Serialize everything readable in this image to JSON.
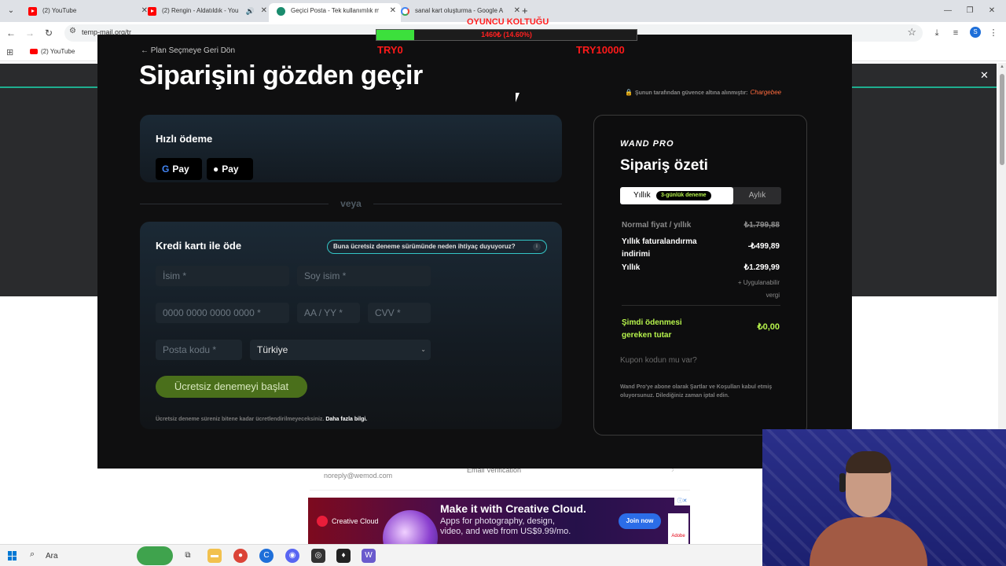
{
  "browser": {
    "tabs": [
      {
        "title": "(2) YouTube",
        "extra": ""
      },
      {
        "title": "(2) Rengin - Aldatıldık - You",
        "extra": "🔊"
      },
      {
        "title": "Geçici Posta - Tek kullanımlık m",
        "extra": ""
      },
      {
        "title": "sanal kart oluşturma - Google A",
        "extra": ""
      }
    ],
    "url": "temp-mail.org/tr",
    "bookmarks": [
      {
        "label": "(2) YouTube"
      }
    ],
    "profile_initial": "S"
  },
  "background_page": {
    "mail": {
      "from": "noreply@wemod.com",
      "subject": "Email Verification"
    }
  },
  "checkout": {
    "back_link": "← Plan Seçmeye Geri Dön",
    "title": "Siparişini gözden geçir",
    "secured_text": "Şunun tarafından güvence altına alınmıştır:",
    "secured_brand": "Chargebee",
    "fast_pay": {
      "title": "Hızlı ödeme",
      "google_pay": "Pay",
      "apple_pay": "Pay"
    },
    "or_text": "veya",
    "card_pay": {
      "title": "Kredi kartı ile öde",
      "why_pill": "Buna ücretsiz deneme sürümünde neden ihtiyaç duyuyoruz?",
      "first_name_placeholder": "İsim *",
      "last_name_placeholder": "Soy isim *",
      "card_number_placeholder": "0000 0000 0000 0000 *",
      "expiry_placeholder": "AA / YY *",
      "cvv_placeholder": "CVV *",
      "postal_placeholder": "Posta kodu *",
      "country_value": "Türkiye",
      "start_button": "Ücretsiz denemeyi başlat",
      "fine_print": "Ücretsiz deneme süreniz bitene kadar ücretlendirilmeyeceksiniz.",
      "more_info": "Daha fazla bilgi."
    },
    "summary": {
      "brand": "WAND PRO",
      "title": "Sipariş özeti",
      "toggle_yearly": "Yıllık",
      "trial_badge": "3-günlük deneme",
      "toggle_monthly": "Aylık",
      "rows": [
        {
          "label": "Normal fiyat / yıllık",
          "value": "₺1.799,88"
        },
        {
          "label": "Yıllık faturalandırma indirimi",
          "value": "-₺499,89"
        },
        {
          "label": "Yıllık",
          "value": "₺1.299,99"
        }
      ],
      "tax_note": "+ Uygulanabilir vergi",
      "due_label": "Şimdi ödenmesi gereken tutar",
      "due_value": "₺0,00",
      "coupon": "Kupon kodun mu var?",
      "terms": "Wand Pro'ye abone olarak Şartlar ve Koşulları kabul etmiş oluyorsunuz. Dilediğiniz zaman iptal edin."
    }
  },
  "game_overlay": {
    "title": "OYUNCU KOLTUĞU",
    "progress_text": "1460₺ (14.60%)",
    "progress_fraction": 0.146,
    "min_label": "TRY0",
    "max_label": "TRY10000"
  },
  "ad": {
    "brand": "Creative Cloud",
    "headline": "Make it with Creative Cloud.",
    "body": "Apps for photography, design, video, and web from US$9.99/mo.",
    "button": "Join now",
    "adobe": "Adobe"
  },
  "taskbar": {
    "search_placeholder": "Ara"
  }
}
